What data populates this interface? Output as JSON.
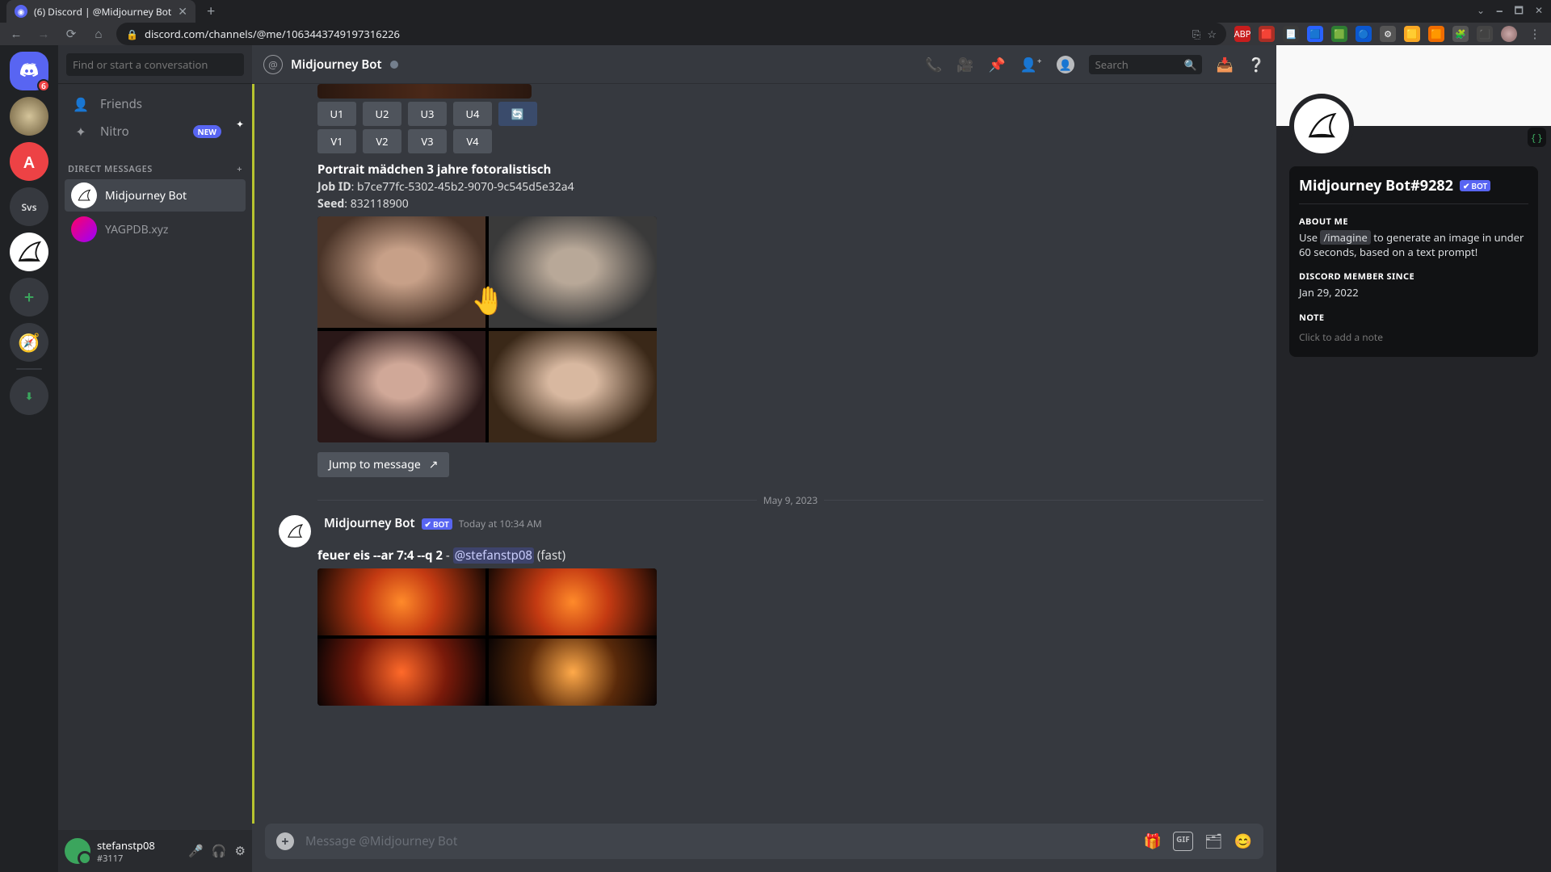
{
  "browser": {
    "tab_title": "(6) Discord | @Midjourney Bot",
    "url": "discord.com/channels/@me/1063443749197316226",
    "window_controls": {
      "min": "🗕",
      "max": "🗖",
      "close": "✕"
    },
    "extensions": [
      "ABP",
      "🟥",
      "📃",
      "🟦",
      "🟩",
      "🔵",
      "⚙",
      "🟨",
      "🟧",
      "🧩",
      "⬛"
    ]
  },
  "guilds": {
    "home_badge": "6",
    "items": [
      {
        "label": "",
        "badge": ""
      },
      {
        "label": "A",
        "badge": ""
      },
      {
        "label": "Svs",
        "badge": ""
      },
      {
        "label": "",
        "badge": ""
      }
    ]
  },
  "sidebar": {
    "search_placeholder": "Find or start a conversation",
    "friends": "Friends",
    "nitro": "Nitro",
    "nitro_new": "NEW",
    "dm_header": "DIRECT MESSAGES",
    "dms": [
      {
        "name": "Midjourney Bot"
      },
      {
        "name": "YAGPDB.xyz"
      }
    ],
    "user": {
      "name": "stefanstp08",
      "tag": "#3117"
    }
  },
  "header": {
    "name": "Midjourney Bot",
    "search_placeholder": "Search"
  },
  "chat": {
    "u_buttons": [
      "U1",
      "U2",
      "U3",
      "U4"
    ],
    "v_buttons": [
      "V1",
      "V2",
      "V3",
      "V4"
    ],
    "portrait_title": "Portrait mädchen 3 jahre fotoralistisch",
    "job_id_label": "Job ID",
    "job_id": "b7ce77fc-5302-45b2-9070-9c545d5e32a4",
    "seed_label": "Seed",
    "seed": "832118900",
    "jump": "Jump to message",
    "divider": "May 9, 2023",
    "author": "Midjourney Bot",
    "bot_tag": "BOT",
    "msg_time": "Today at 10:34 AM",
    "prompt_bold": "feuer eis --ar 7:4 --q 2",
    "prompt_sep": " - ",
    "prompt_mention": "@stefanstp08",
    "prompt_fast": " (fast)"
  },
  "composer": {
    "placeholder": "Message @Midjourney Bot"
  },
  "profile": {
    "name": "Midjourney Bot#9282",
    "bot_tag": "BOT",
    "about_h": "ABOUT ME",
    "about_pre": "Use ",
    "about_chip": "/imagine",
    "about_post": " to generate an image in under 60 seconds, based on a text prompt!",
    "member_h": "DISCORD MEMBER SINCE",
    "member_since": "Jan 29, 2022",
    "note_h": "NOTE",
    "note_placeholder": "Click to add a note"
  }
}
